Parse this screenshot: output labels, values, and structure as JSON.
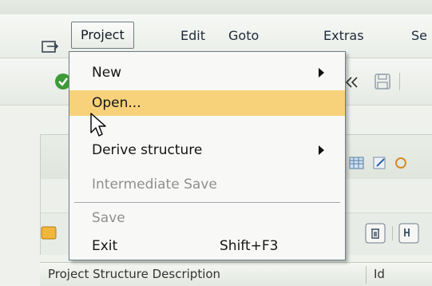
{
  "menubar": {
    "items": [
      {
        "label": "Project"
      },
      {
        "label": "Edit"
      },
      {
        "label": "Goto"
      },
      {
        "label": "Extras"
      },
      {
        "label": "Se"
      }
    ]
  },
  "dropdown": {
    "items": [
      {
        "label": "New",
        "submenu": true,
        "state": "normal"
      },
      {
        "label": "Open...",
        "state": "highlighted"
      },
      {
        "label": "Derive structure",
        "submenu": true,
        "state": "normal"
      },
      {
        "label": "Intermediate Save",
        "state": "disabled"
      },
      {
        "label": "Save",
        "state": "disabled"
      },
      {
        "label": "Exit",
        "shortcut": "Shift+F3",
        "state": "normal"
      }
    ]
  },
  "grid": {
    "col1": "Project Structure Description",
    "col2": "Id"
  },
  "icons": {
    "menu": "menu-toggle-icon",
    "cursor": "mouse-pointer-icon",
    "back": "double-left-arrow-icon",
    "save": "save-disk-icon",
    "delete": "trash-icon",
    "binoculars": "find-icon"
  },
  "colors": {
    "highlight": "#f8d27a",
    "disabled_text": "#8f8f8f",
    "menu_border": "#6f7b86"
  }
}
